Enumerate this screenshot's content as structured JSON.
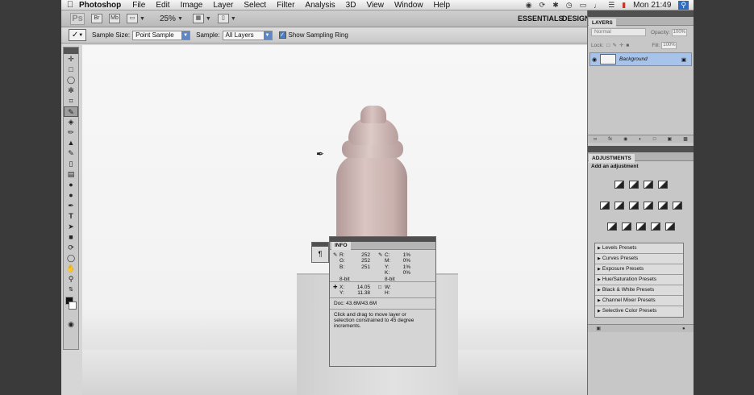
{
  "menubar": {
    "app_name": "Photoshop",
    "items": [
      "File",
      "Edit",
      "Image",
      "Layer",
      "Select",
      "Filter",
      "Analysis",
      "3D",
      "View",
      "Window",
      "Help"
    ],
    "clock": "Mon 21:49"
  },
  "appbar": {
    "logo": "Ps",
    "zoom": "25%",
    "workspaces": [
      "ESSENTIALS",
      "DESIGN"
    ]
  },
  "options": {
    "sample_size_label": "Sample Size:",
    "sample_size_value": "Point Sample",
    "sample_label": "Sample:",
    "sample_value": "All Layers",
    "show_ring_label": "Show Sampling Ring"
  },
  "info_panel": {
    "tab": "INFO",
    "rgb": {
      "r_label": "R:",
      "r": "252",
      "g_label": "G:",
      "g": "252",
      "b_label": "B:",
      "b": "251"
    },
    "cmyk": {
      "c_label": "C:",
      "c": "1%",
      "m_label": "M:",
      "m": "0%",
      "y_label": "Y:",
      "y": "1%",
      "k_label": "K:",
      "k": "0%"
    },
    "bit_depth_1": "8-bit",
    "bit_depth_2": "8-bit",
    "xy": {
      "x_label": "X:",
      "x": "14.05",
      "y_label": "Y:",
      "y": "11.38"
    },
    "wh": {
      "w_label": "W:",
      "h_label": "H:"
    },
    "doc": "Doc: 43.6M/43.6M",
    "hint": "Click and drag to move layer or selection constrained to 45 degree increments."
  },
  "layers_panel": {
    "tab": "LAYERS",
    "blend_mode": "Normal",
    "opacity_label": "Opacity:",
    "opacity": "100%",
    "lock_label": "Lock:",
    "fill_label": "Fill:",
    "fill": "100%",
    "layer_name": "Background"
  },
  "adjustments_panel": {
    "tab": "ADJUSTMENTS",
    "title": "Add an adjustment",
    "presets": [
      "Levels Presets",
      "Curves Presets",
      "Exposure Presets",
      "Hue/Saturation Presets",
      "Black & White Presets",
      "Channel Mixer Presets",
      "Selective Color Presets"
    ]
  }
}
